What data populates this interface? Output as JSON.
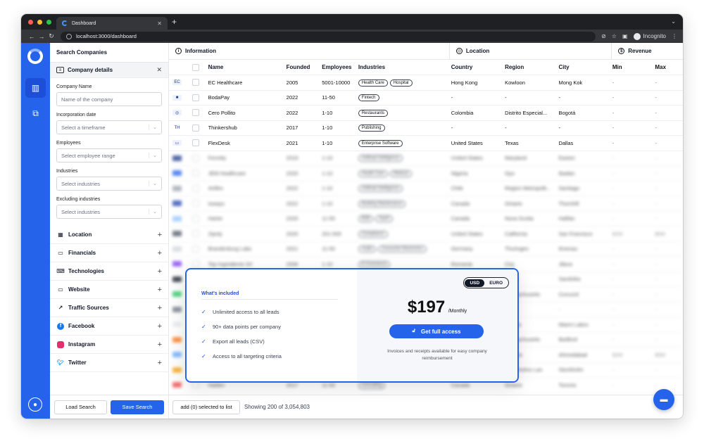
{
  "browser": {
    "tab_title": "Dashboard",
    "url": "localhost:3000/dashboard",
    "profile": "Incognito"
  },
  "filters": {
    "title": "Search Companies",
    "section": "Company details",
    "company_name_label": "Company Name",
    "company_name_placeholder": "Name of the company",
    "incorporation_label": "Incorporation date",
    "incorporation_placeholder": "Select a timeframe",
    "employees_label": "Employees",
    "employees_placeholder": "Select employee range",
    "industries_label": "Industries",
    "industries_placeholder": "Select industries",
    "excluding_label": "Excluding industries",
    "excluding_placeholder": "Select industries",
    "collapsibles": [
      "Location",
      "Financials",
      "Technologies",
      "Website",
      "Traffic Sources",
      "Facebook",
      "Instagram",
      "Twitter"
    ],
    "load_label": "Load Search",
    "save_label": "Save Search"
  },
  "table": {
    "groups": {
      "information": "Information",
      "location": "Location",
      "revenue": "Revenue"
    },
    "headers": {
      "name": "Name",
      "founded": "Founded",
      "employees": "Employees",
      "industries": "Industries",
      "country": "Country",
      "region": "Region",
      "city": "City",
      "min": "Min",
      "max": "Max"
    },
    "rows": [
      {
        "name": "EC Healthcare",
        "founded": "2005",
        "employees": "5001-10000",
        "industries": [
          "Health Care",
          "Hospital"
        ],
        "country": "Hong Kong",
        "region": "Kowloon",
        "city": "Mong Kok",
        "min": "-",
        "max": "-"
      },
      {
        "name": "BodaPay",
        "founded": "2022",
        "employees": "11-50",
        "industries": [
          "Fintech"
        ],
        "country": "-",
        "region": "-",
        "city": "-",
        "min": "-",
        "max": "-"
      },
      {
        "name": "Cero Pollito",
        "founded": "2022",
        "employees": "1-10",
        "industries": [
          "Restaurants"
        ],
        "country": "Colombia",
        "region": "Distrito Especial...",
        "city": "Bogotá",
        "min": "-",
        "max": "-"
      },
      {
        "name": "Thinkershub",
        "founded": "2017",
        "employees": "1-10",
        "industries": [
          "Publishing"
        ],
        "country": "-",
        "region": "-",
        "city": "-",
        "min": "-",
        "max": "-"
      },
      {
        "name": "FlexDesk",
        "founded": "2021",
        "employees": "1-10",
        "industries": [
          "Enterprise Software"
        ],
        "country": "United States",
        "region": "Texas",
        "city": "Dallas",
        "min": "-",
        "max": "-"
      }
    ],
    "blurred_rows": [
      {
        "name": "Ferreity",
        "founded": "2019",
        "employees": "1-10",
        "industries": [
          "Artificial Intelligence"
        ],
        "country": "United States",
        "region": "Maryland",
        "city": "Easton",
        "min": "-",
        "max": "-"
      },
      {
        "name": "JEM Healthcare",
        "founded": "2020",
        "employees": "1-10",
        "industries": [
          "Health Care",
          "Medical"
        ],
        "country": "Nigeria",
        "region": "Oyo",
        "city": "Ibadan",
        "min": "-",
        "max": "-"
      },
      {
        "name": "Artifex",
        "founded": "2022",
        "employees": "1-10",
        "industries": [
          "Artificial Intelligence"
        ],
        "country": "Chile",
        "region": "Region Metropolit...",
        "city": "Santiago",
        "min": "-",
        "max": "-"
      },
      {
        "name": "Ioways",
        "founded": "2022",
        "employees": "1-10",
        "industries": [
          "Building Maintenance"
        ],
        "country": "Canada",
        "region": "Ontario",
        "city": "Thornhill",
        "min": "-",
        "max": "-"
      },
      {
        "name": "Harter",
        "founded": "2020",
        "employees": "11-50",
        "industries": [
          "B2B",
          "SaaS"
        ],
        "country": "Canada",
        "region": "Nova Scotia",
        "city": "Halifax",
        "min": "-",
        "max": "-"
      },
      {
        "name": "Zipnly",
        "founded": "2020",
        "employees": "201-500",
        "industries": [
          "Compliance"
        ],
        "country": "United States",
        "region": "California",
        "city": "San Francisco",
        "min": "$2M",
        "max": "$5M"
      },
      {
        "name": "Brandenburg Labs",
        "founded": "2021",
        "employees": "11-50",
        "industries": [
          "Audio",
          "Consumer Electronics"
        ],
        "country": "Germany",
        "region": "Thuringen",
        "city": "Ilmenau",
        "min": "-",
        "max": "-"
      },
      {
        "name": "Top Ingredients Srl",
        "founded": "2006",
        "employees": "1-10",
        "industries": [
          "E-Commerce"
        ],
        "country": "Romania",
        "region": "Cluj",
        "city": "Jilava",
        "min": "-",
        "max": "-"
      },
      {
        "name": "Nordis",
        "founded": "2021",
        "employees": "1-10",
        "industries": [
          "Software"
        ],
        "country": "Norway",
        "region": "Viken",
        "city": "Sandvika",
        "min": "-",
        "max": "-"
      },
      {
        "name": "Copperleaf",
        "founded": "2018",
        "employees": "11-50",
        "industries": [
          "Analytics"
        ],
        "country": "United States",
        "region": "Massachusetts",
        "city": "Concord",
        "min": "-",
        "max": "-"
      },
      {
        "name": "Rheo",
        "founded": "2022",
        "employees": "1-10",
        "industries": [
          "Fintech"
        ],
        "country": "-",
        "region": "-",
        "city": "-",
        "min": "-",
        "max": "-"
      },
      {
        "name": "Pinwheel",
        "founded": "2019",
        "employees": "1-10",
        "industries": [
          "Health Care"
        ],
        "country": "United States",
        "region": "Florida",
        "city": "Miami Lakes",
        "min": "-",
        "max": "-"
      },
      {
        "name": "Lumenad",
        "founded": "2020",
        "employees": "1-10",
        "industries": [
          "Marketing"
        ],
        "country": "United States",
        "region": "Massachusetts",
        "city": "Bedford",
        "min": "-",
        "max": "-"
      },
      {
        "name": "Kairos",
        "founded": "2012",
        "employees": "51-200",
        "industries": [
          "Manufacturing"
        ],
        "country": "India",
        "region": "Gujarat",
        "city": "Ahmedabad",
        "min": "$2M",
        "max": "$5M"
      },
      {
        "name": "Svea Labs",
        "founded": "2021",
        "employees": "1-10",
        "industries": [
          "Software"
        ],
        "country": "Sweden",
        "region": "Stockholms Lan",
        "city": "Stockholm",
        "min": "-",
        "max": "-"
      },
      {
        "name": "Halden",
        "founded": "2017",
        "employees": "11-50",
        "industries": [
          "Consulting"
        ],
        "country": "Canada",
        "region": "Ontario",
        "city": "Toronto",
        "min": "-",
        "max": "-"
      },
      {
        "name": "Finning International",
        "founded": "1933",
        "employees": "5001+",
        "industries": [
          "Construction"
        ],
        "country": "Canada",
        "region": "British Columbia",
        "city": "Vancouver",
        "min": "$1B",
        "max": "-"
      }
    ]
  },
  "bottom": {
    "add_label": "add (0) selected to list",
    "showing": "Showing 200 of 3,054,803"
  },
  "modal": {
    "heading": "What's included",
    "features": [
      "Unlimited access to all leads",
      "90+ data points per company",
      "Export all leads (CSV)",
      "Access to all targeting criteria"
    ],
    "currency_usd": "USD",
    "currency_euro": "EURO",
    "price": "$197",
    "period": "/Monthly",
    "cta": "Get full access",
    "note": "Invoices and receipts available for easy company reimbursement"
  },
  "colors": {
    "accent": "#2563eb",
    "rail": "#2563eb"
  }
}
